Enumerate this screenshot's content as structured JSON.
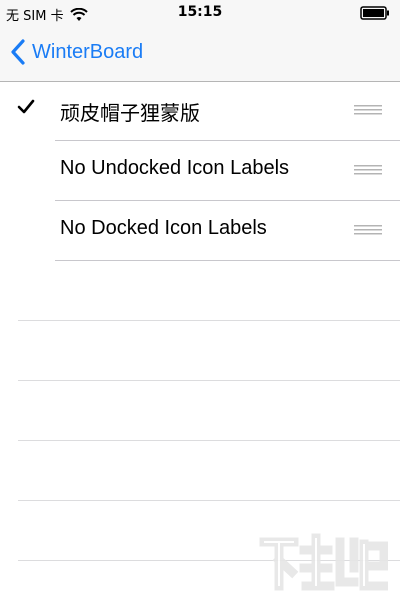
{
  "status": {
    "carrier": "无 SIM 卡",
    "time": "15:15"
  },
  "nav": {
    "back_label": "WinterBoard"
  },
  "rows": [
    {
      "label": "顽皮帽子狸蒙版",
      "checked": true
    },
    {
      "label": "No Undocked Icon Labels",
      "checked": false
    },
    {
      "label": "No Docked Icon Labels",
      "checked": false
    }
  ],
  "icons": {
    "back": "chevron-left",
    "check": "checkmark",
    "reorder": "reorder-handle"
  },
  "colors": {
    "accent": "#1a7cf5",
    "separator": "#c8c7cc",
    "bar_bg": "#f7f7f7"
  }
}
